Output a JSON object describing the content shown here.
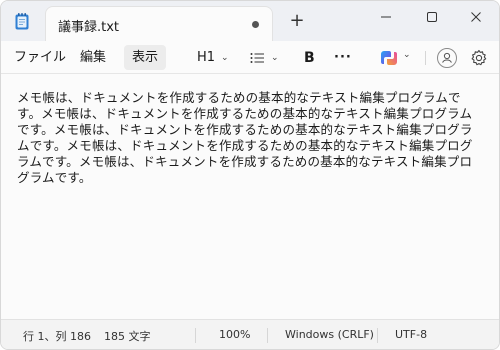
{
  "tab": {
    "title": "議事録.txt",
    "new_tab_label": "+"
  },
  "menu": {
    "file": "ファイル",
    "edit": "編集",
    "view": "表示"
  },
  "toolbar": {
    "heading": "H1",
    "bold": "B",
    "more": "···"
  },
  "icons": {
    "app": "notepad-icon",
    "list": "list-icon",
    "copilot": "copilot-icon",
    "account": "account-icon",
    "settings": "gear-icon",
    "minimize": "minimize-icon",
    "maximize": "maximize-icon",
    "close": "close-icon",
    "unsaved": "unsaved-dot-icon"
  },
  "document": {
    "text": "メモ帳は、ドキュメントを作成するための基本的なテキスト編集プログラムです。メモ帳は、ドキュメントを作成するための基本的なテキスト編集プログラムです。メモ帳は、ドキュメントを作成するための基本的なテキスト編集プログラムです。メモ帳は、ドキュメントを作成するための基本的なテキスト編集プログラムです。メモ帳は、ドキュメントを作成するための基本的なテキスト編集プログラムです。"
  },
  "status": {
    "position": "行 1、列 186",
    "char_count": "185 文字",
    "zoom": "100%",
    "line_ending": "Windows (CRLF)",
    "encoding": "UTF-8"
  },
  "colors": {
    "titlebar": "#eef0f4",
    "editor_bg": "#fbfbfb",
    "statusbar": "#f3f3f3",
    "app_icon": "#2f7fd3"
  }
}
